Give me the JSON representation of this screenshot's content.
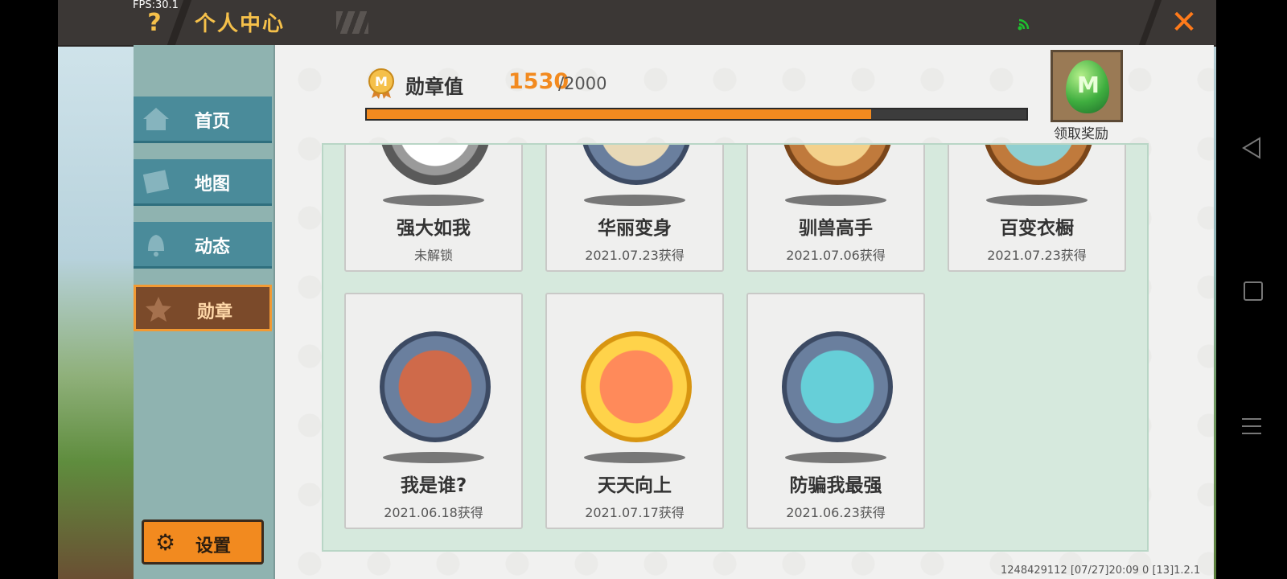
{
  "status": {
    "fps": "FPS:30.1"
  },
  "header": {
    "help_icon": "?",
    "title": "个人中心",
    "close_icon": "✕"
  },
  "sidebar": {
    "items": [
      {
        "label": "首页",
        "icon": "home-icon"
      },
      {
        "label": "地图",
        "icon": "map-icon"
      },
      {
        "label": "动态",
        "icon": "bell-icon"
      },
      {
        "label": "勋章",
        "icon": "medal-icon",
        "active": true
      }
    ],
    "settings_label": "设置",
    "settings_icon": "gear-icon"
  },
  "medal": {
    "label": "勋章值",
    "value": "1530",
    "max_text": "/2000",
    "progress": 0.765,
    "reward_label": "领取奖励",
    "reward_egg_letter": "M"
  },
  "cards": [
    {
      "name": "强大如我",
      "date": "未解锁"
    },
    {
      "name": "华丽变身",
      "date": "2021.07.23获得"
    },
    {
      "name": "驯兽高手",
      "date": "2021.07.06获得"
    },
    {
      "name": "百变衣橱",
      "date": "2021.07.23获得"
    },
    {
      "name": "我是谁?",
      "date": "2021.06.18获得"
    },
    {
      "name": "天天向上",
      "date": "2021.07.17获得"
    },
    {
      "name": "防骗我最强",
      "date": "2021.06.23获得"
    }
  ],
  "footer": {
    "text": "1248429112   [07/27]20:09 0   [13]1.2.1"
  },
  "colors": {
    "accent": "#f28a1f",
    "sidebar": "#4a8b9a",
    "active_tab": "#7b4a2a",
    "title": "#f5c04a"
  }
}
